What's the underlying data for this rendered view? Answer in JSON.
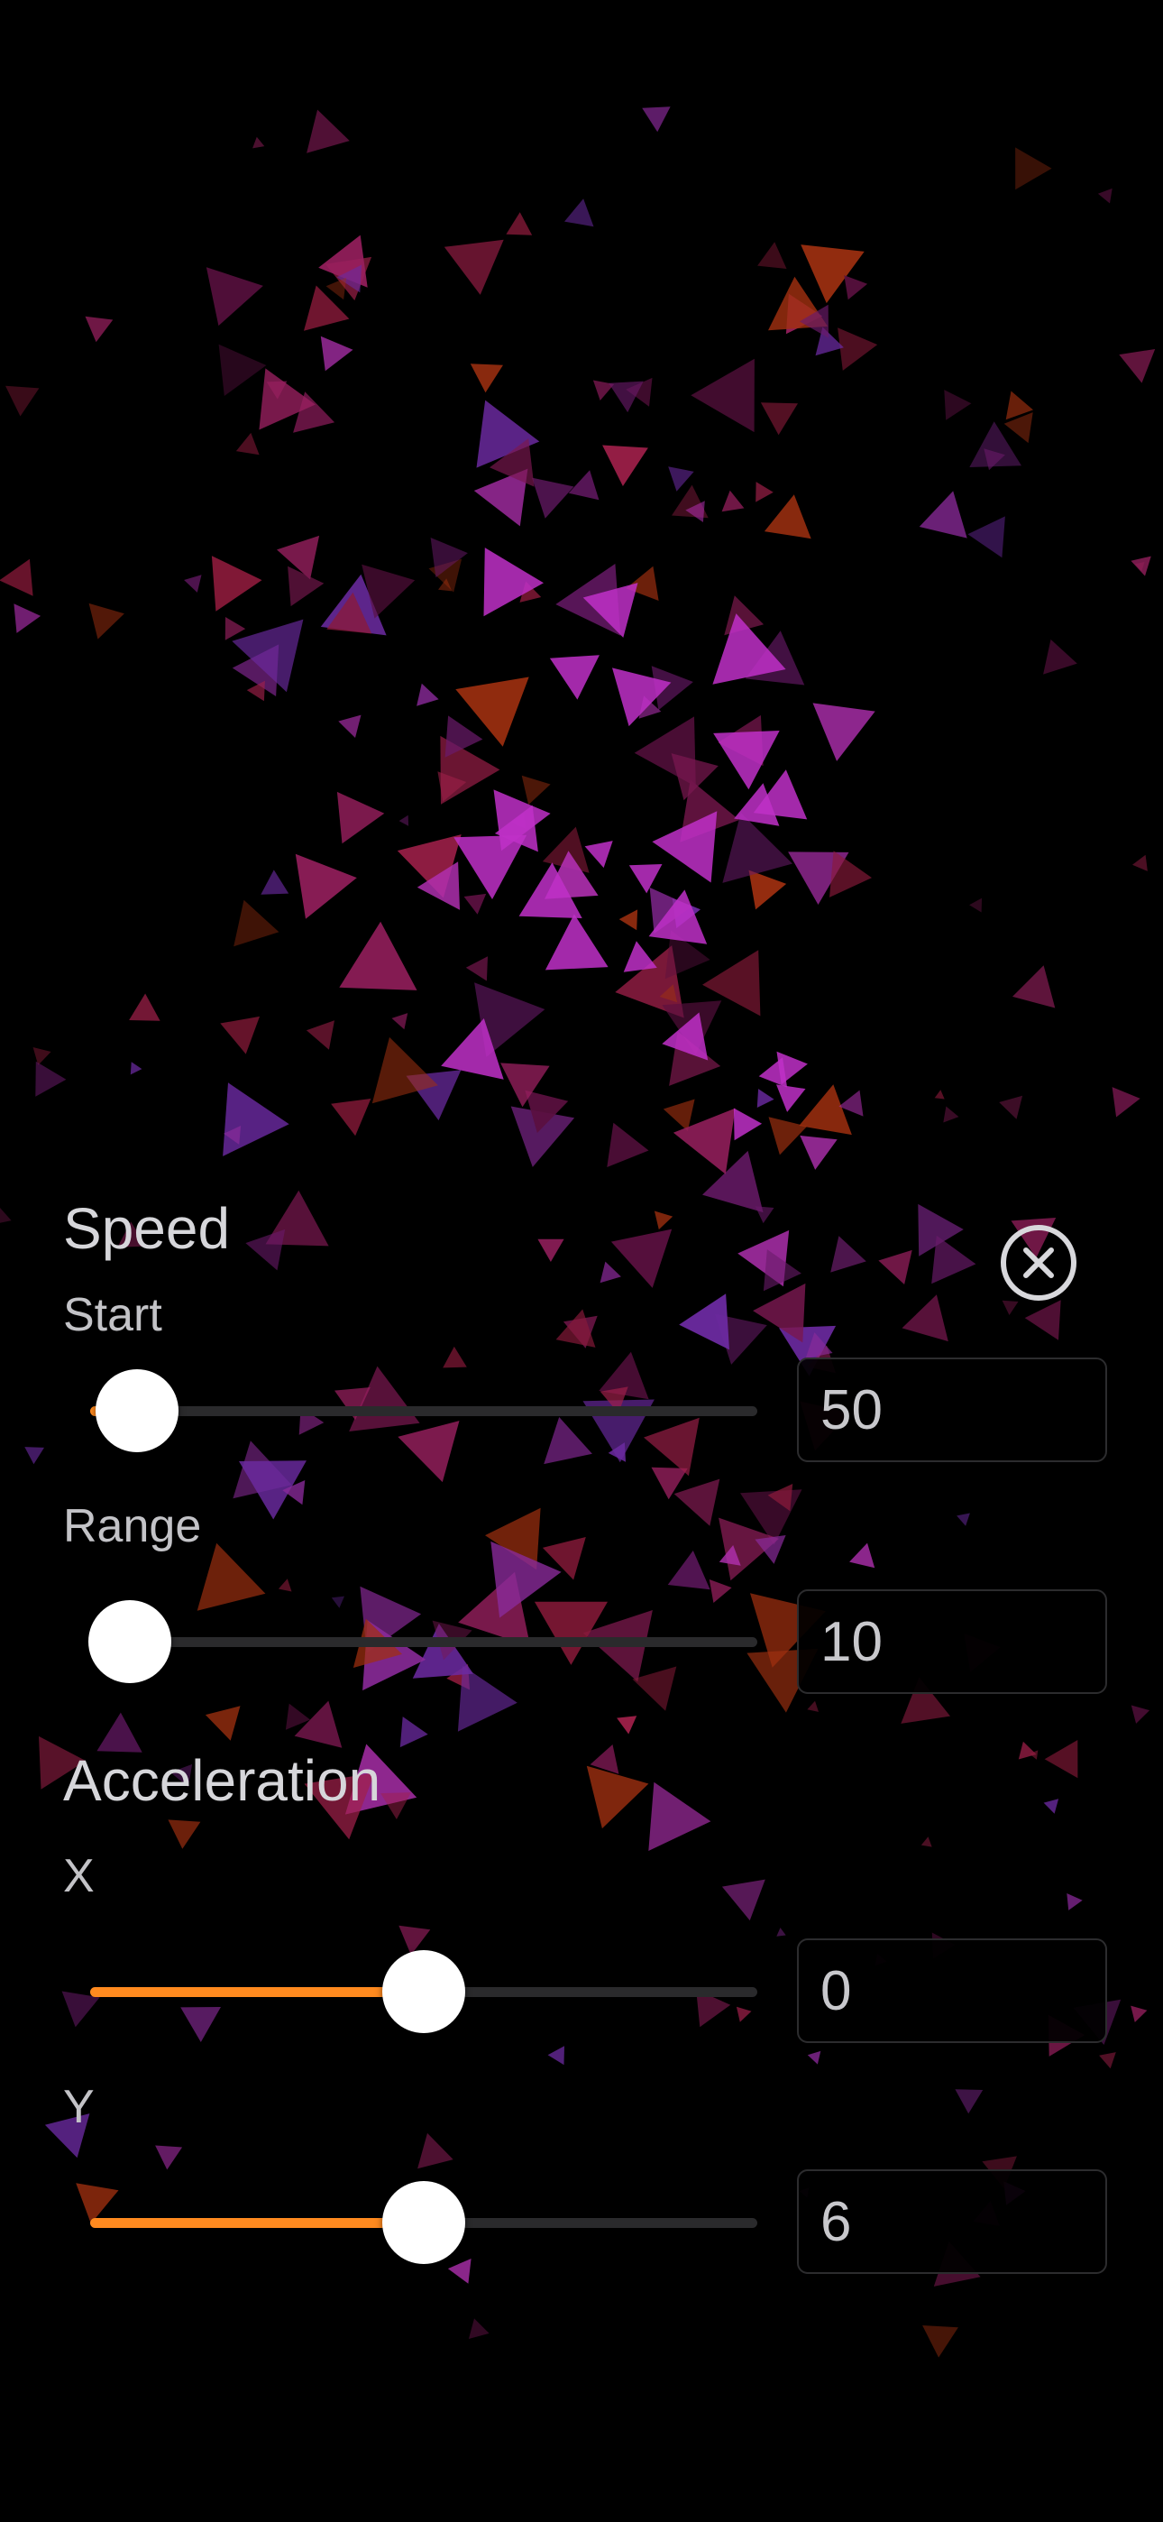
{
  "background_color": "#000000",
  "accent_color": "#ff8a1f",
  "close_icon": "circle-x-icon",
  "speed": {
    "title": "Speed",
    "start": {
      "label": "Start",
      "value": "50",
      "slider_fraction": 0.07
    },
    "range": {
      "label": "Range",
      "value": "10",
      "slider_fraction": 0.06
    }
  },
  "acceleration": {
    "title": "Acceleration",
    "x": {
      "label": "X",
      "value": "0",
      "slider_fraction": 0.5
    },
    "y": {
      "label": "Y",
      "value": "6",
      "slider_fraction": 0.5
    }
  }
}
